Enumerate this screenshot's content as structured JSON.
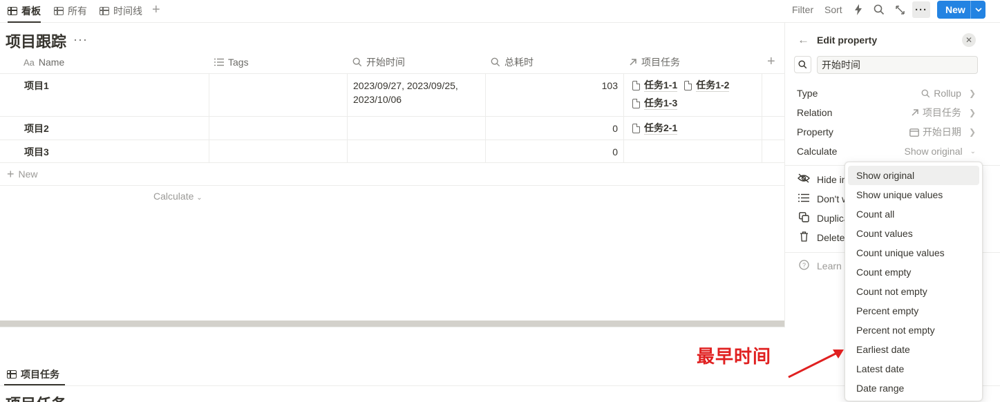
{
  "views": {
    "tabs": [
      {
        "label": "看板",
        "active": true
      },
      {
        "label": "所有",
        "active": false
      },
      {
        "label": "时间线",
        "active": false
      }
    ],
    "add": "+"
  },
  "toolbar": {
    "filter": "Filter",
    "sort": "Sort",
    "new": "New"
  },
  "database": {
    "title": "项目跟踪",
    "columns": [
      {
        "label": "Name",
        "icon": "Aa"
      },
      {
        "label": "Tags",
        "icon": "list-icon"
      },
      {
        "label": "开始时间",
        "icon": "rollup-icon"
      },
      {
        "label": "总耗时",
        "icon": "rollup-icon"
      },
      {
        "label": "项目任务",
        "icon": "relation-arrow-icon"
      }
    ],
    "rows": [
      {
        "name": "项目1",
        "tags": "",
        "start": "2023/09/27, 2023/09/25, 2023/10/06",
        "total": "103",
        "tasks": [
          "任务1-1",
          "任务1-2",
          "任务1-3"
        ]
      },
      {
        "name": "项目2",
        "tags": "",
        "start": "",
        "total": "0",
        "tasks": [
          "任务2-1"
        ]
      },
      {
        "name": "项目3",
        "tags": "",
        "start": "",
        "total": "0",
        "tasks": []
      }
    ],
    "new_row": "New",
    "calculate": "Calculate"
  },
  "bottom": {
    "tab": "项目任务",
    "title": "项目任务"
  },
  "panel": {
    "title": "Edit property",
    "name_value": "开始时间",
    "type": {
      "key": "Type",
      "value": "Rollup"
    },
    "relation": {
      "key": "Relation",
      "value": "项目任务"
    },
    "property": {
      "key": "Property",
      "value": "开始日期"
    },
    "calculate": {
      "key": "Calculate",
      "value": "Show original"
    },
    "actions": [
      "Hide in view",
      "Don't wrap text",
      "Duplicate property",
      "Delete property"
    ],
    "learn": "Learn about rollups"
  },
  "dropdown": {
    "options": [
      "Show original",
      "Show unique values",
      "Count all",
      "Count values",
      "Count unique values",
      "Count empty",
      "Count not empty",
      "Percent empty",
      "Percent not empty",
      "Earliest date",
      "Latest date",
      "Date range"
    ],
    "selected": "Show original"
  },
  "annotation": {
    "text": "最早时间",
    "color": "#e02020"
  },
  "colors": {
    "accent": "#2383e2",
    "text": "#37352f",
    "muted": "#9b9a97",
    "band": "#d3d1cb"
  }
}
